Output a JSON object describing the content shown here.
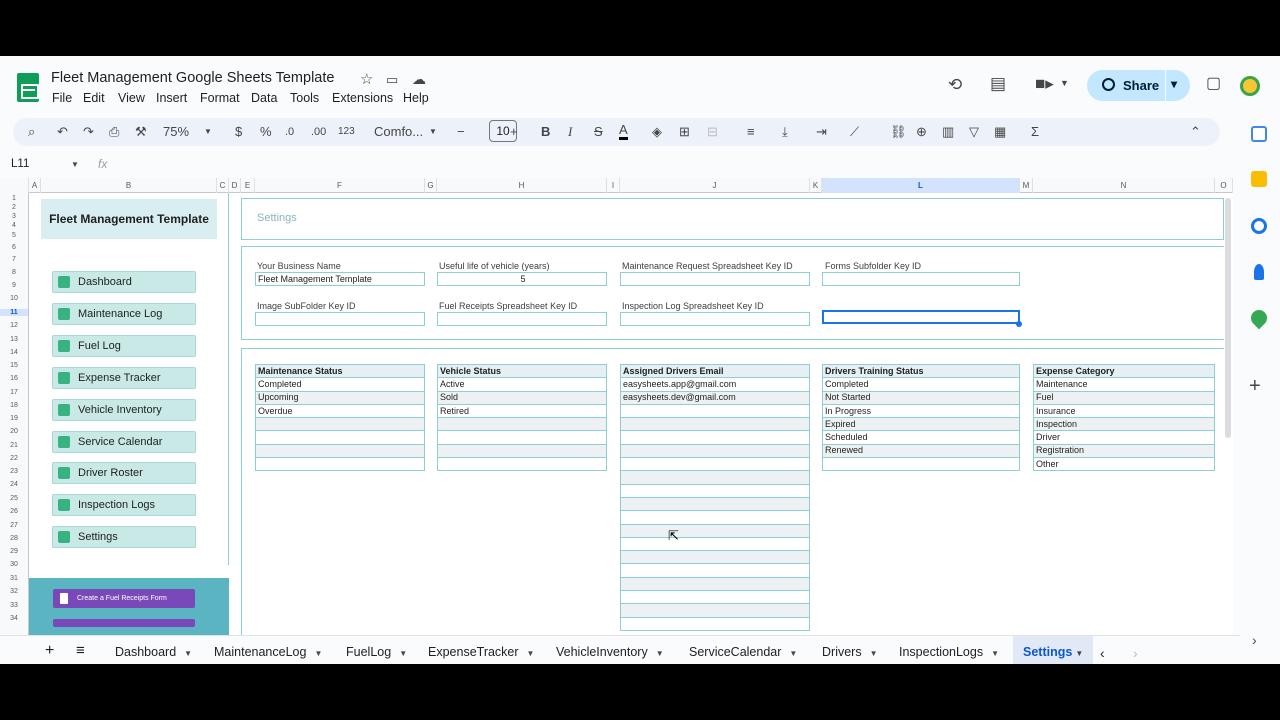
{
  "title": "Fleet Management Google Sheets Template",
  "menu": [
    "File",
    "Edit",
    "View",
    "Insert",
    "Format",
    "Data",
    "Tools",
    "Extensions",
    "Help"
  ],
  "share_label": "Share",
  "toolbar": {
    "zoom": "75%",
    "currency": "$",
    "percent": "%",
    "dec_dec": ".0",
    "dec_inc": ".00",
    "format_num": "123",
    "font": "Comfo...",
    "font_size": "10",
    "bold": "B",
    "italic": "I",
    "strike": "S",
    "text_color": "A"
  },
  "namebox": "L11",
  "fx": "fx",
  "columns": [
    "A",
    "B",
    "C",
    "D",
    "E",
    "F",
    "G",
    "H",
    "I",
    "J",
    "K",
    "L",
    "M",
    "N",
    "O"
  ],
  "rows": [
    "1",
    "2",
    "3",
    "4",
    "5",
    "6",
    "7",
    "8",
    "9",
    "10",
    "11",
    "12",
    "13",
    "14",
    "15",
    "16",
    "17",
    "18",
    "19",
    "20",
    "21",
    "22",
    "23",
    "24",
    "25",
    "26",
    "27",
    "28",
    "29",
    "30",
    "31",
    "32",
    "33",
    "34"
  ],
  "sidebar": {
    "title": "Fleet Management Template",
    "items": [
      "Dashboard",
      "Maintenance Log",
      "Fuel Log",
      "Expense Tracker",
      "Vehicle Inventory",
      "Service Calendar",
      "Driver Roster",
      "Inspection Logs",
      "Settings"
    ],
    "form_button": "Create a Fuel Receipts Form"
  },
  "settings": {
    "title": "Settings",
    "fields": [
      {
        "label": "Your Business Name",
        "value": "Fleet Management Template"
      },
      {
        "label": "Useful life of vehicle (years)",
        "value": "5"
      },
      {
        "label": "Maintenance Request Spreadsheet Key ID",
        "value": ""
      },
      {
        "label": "Forms Subfolder Key ID",
        "value": ""
      },
      {
        "label": "Image SubFolder Key ID",
        "value": ""
      },
      {
        "label": "Fuel Receipts Spreadsheet Key ID",
        "value": ""
      },
      {
        "label": "Inspection Log Spreadsheet Key ID",
        "value": ""
      }
    ],
    "tables": [
      {
        "header": "Maintenance Status",
        "values": [
          "Completed",
          "Upcoming",
          "Overdue"
        ]
      },
      {
        "header": "Vehicle Status",
        "values": [
          "Active",
          "Sold",
          "Retired"
        ]
      },
      {
        "header": "Assigned Drivers Email",
        "values": [
          "easysheets.app@gmail.com",
          "easysheets.dev@gmail.com"
        ]
      },
      {
        "header": "Drivers Training Status",
        "values": [
          "Completed",
          "Not Started",
          "In Progress",
          "Expired",
          "Scheduled",
          "Renewed"
        ]
      },
      {
        "header": "Expense Category",
        "values": [
          "Maintenance",
          "Fuel",
          "Insurance",
          "Inspection",
          "Driver",
          "Registration",
          "Other"
        ]
      }
    ]
  },
  "sheet_tabs": [
    "Dashboard",
    "MaintenanceLog",
    "FuelLog",
    "ExpenseTracker",
    "VehicleInventory",
    "ServiceCalendar",
    "Drivers",
    "InspectionLogs",
    "Settings"
  ],
  "active_tab": "Settings",
  "colors": {
    "accent": "#8ecfd0",
    "nav_button": "#c9e9e6",
    "form_panel": "#5ab4c2",
    "form_button": "#7a49b9",
    "share": "#c2e7ff",
    "selection": "#1a73e8"
  }
}
